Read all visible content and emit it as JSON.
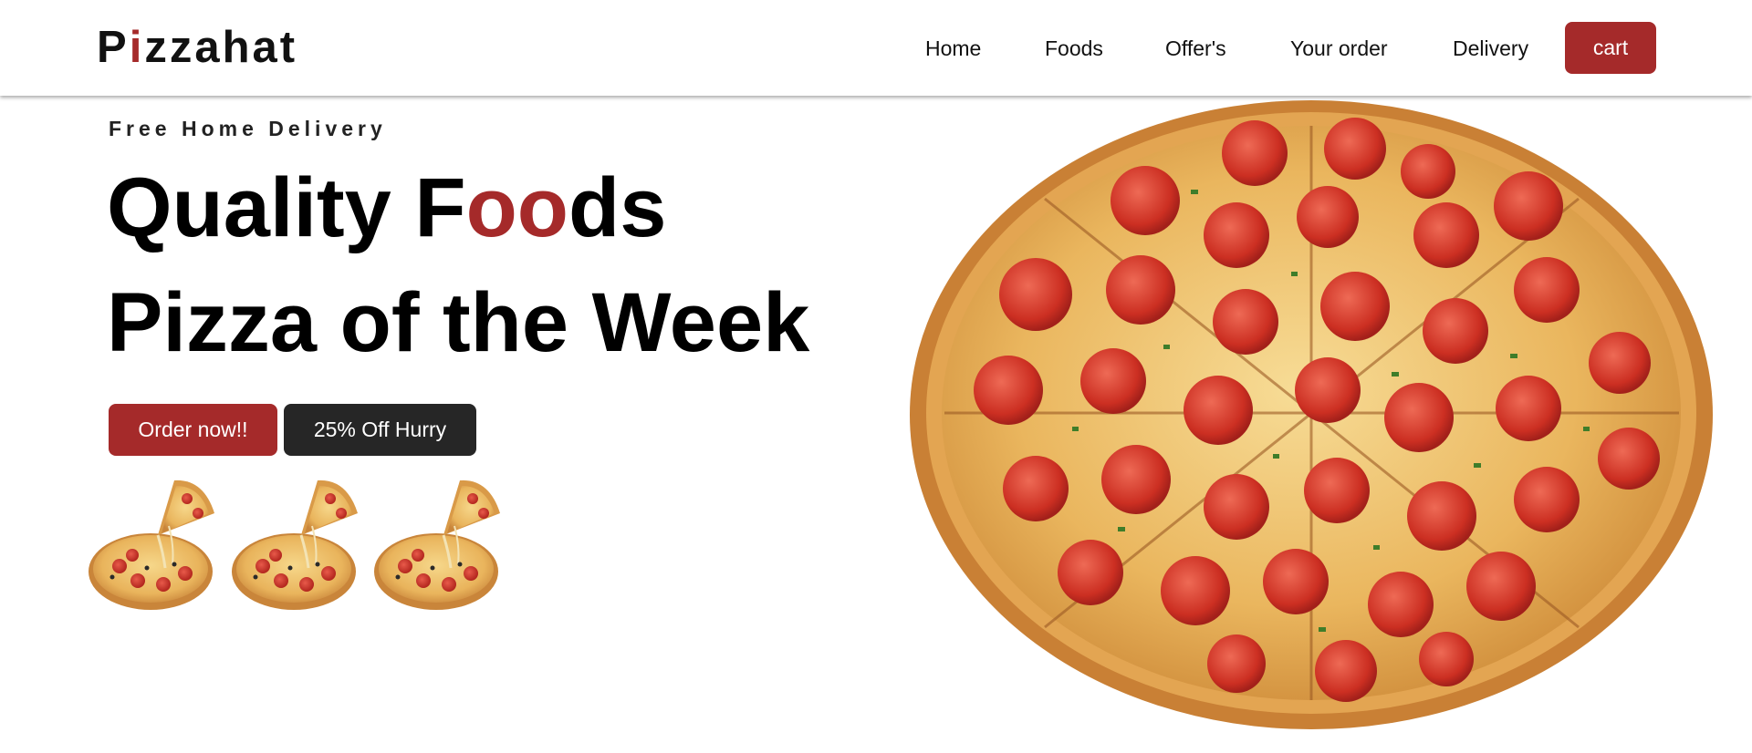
{
  "brand": {
    "logo_first": "P",
    "logo_accent": "i",
    "logo_rest": "zzahat",
    "accent_color": "#a52a2a"
  },
  "nav": {
    "items": [
      {
        "label": "Home"
      },
      {
        "label": "Foods"
      },
      {
        "label": "Offer's"
      },
      {
        "label": "Your order"
      },
      {
        "label": "Delivery"
      }
    ],
    "cart_label": "cart"
  },
  "hero": {
    "tagline": "Free Home Delivery",
    "headline1_pre": "Quality F",
    "headline1_accent": "oo",
    "headline1_post": "ds",
    "headline2": "Pizza of the Week",
    "order_button": "Order now!!",
    "offer_button": "25% Off Hurry",
    "thumbnail_icon": "pizza-slice-image",
    "main_image_icon": "pepperoni-pizza-image"
  },
  "colors": {
    "primary": "#a52a2a",
    "dark": "#262626",
    "background": "#ffffff"
  }
}
